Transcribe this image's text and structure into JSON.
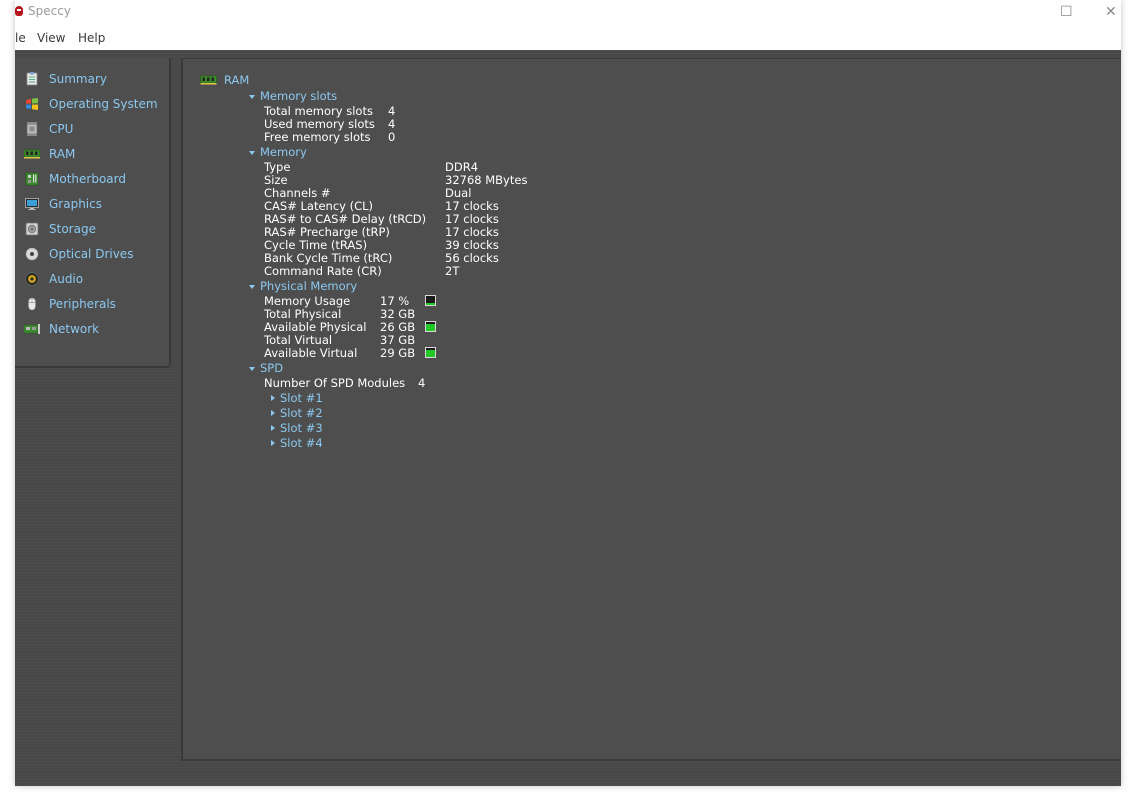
{
  "window": {
    "title": "Speccy",
    "controls": {
      "maximize": "☐",
      "close": "✕"
    }
  },
  "menu": {
    "items": [
      "le",
      "View",
      "Help"
    ]
  },
  "sidebar": {
    "items": [
      {
        "label": "Summary",
        "icon": "summary-icon",
        "selected": false
      },
      {
        "label": "Operating System",
        "icon": "windows-icon",
        "selected": false
      },
      {
        "label": "CPU",
        "icon": "cpu-icon",
        "selected": false
      },
      {
        "label": "RAM",
        "icon": "ram-icon",
        "selected": true
      },
      {
        "label": "Motherboard",
        "icon": "motherboard-icon",
        "selected": false
      },
      {
        "label": "Graphics",
        "icon": "monitor-icon",
        "selected": false
      },
      {
        "label": "Storage",
        "icon": "hard-drive-icon",
        "selected": false
      },
      {
        "label": "Optical Drives",
        "icon": "optical-disc-icon",
        "selected": false
      },
      {
        "label": "Audio",
        "icon": "speaker-icon",
        "selected": false
      },
      {
        "label": "Peripherals",
        "icon": "mouse-icon",
        "selected": false
      },
      {
        "label": "Network",
        "icon": "network-icon",
        "selected": false
      }
    ]
  },
  "content": {
    "title": "RAM",
    "memory_slots": {
      "heading": "Memory slots",
      "rows": [
        {
          "label": "Total memory slots",
          "value": "4"
        },
        {
          "label": "Used memory slots",
          "value": "4"
        },
        {
          "label": "Free memory slots",
          "value": "0"
        }
      ]
    },
    "memory": {
      "heading": "Memory",
      "rows": [
        {
          "label": "Type",
          "value": "DDR4"
        },
        {
          "label": "Size",
          "value": "32768 MBytes"
        },
        {
          "label": "Channels #",
          "value": "Dual"
        },
        {
          "label": "CAS# Latency (CL)",
          "value": "17 clocks"
        },
        {
          "label": "RAS# to CAS# Delay (tRCD)",
          "value": "17 clocks"
        },
        {
          "label": "RAS# Precharge (tRP)",
          "value": "17 clocks"
        },
        {
          "label": "Cycle Time (tRAS)",
          "value": "39 clocks"
        },
        {
          "label": "Bank Cycle Time (tRC)",
          "value": "56 clocks"
        },
        {
          "label": "Command Rate (CR)",
          "value": "2T"
        }
      ]
    },
    "physical_memory": {
      "heading": "Physical Memory",
      "rows": [
        {
          "label": "Memory Usage",
          "value": "17 %",
          "bar_fraction": 0.17
        },
        {
          "label": "Total Physical",
          "value": "32 GB"
        },
        {
          "label": "Available Physical",
          "value": "26 GB",
          "bar_fraction": 0.81
        },
        {
          "label": "Total Virtual",
          "value": "37 GB"
        },
        {
          "label": "Available Virtual",
          "value": "29 GB",
          "bar_fraction": 0.78
        }
      ]
    },
    "spd": {
      "heading": "SPD",
      "modules_label": "Number Of SPD Modules",
      "modules_value": "4",
      "slots": [
        "Slot #1",
        "Slot #2",
        "Slot #3",
        "Slot #4"
      ]
    }
  },
  "colors": {
    "link_blue": "#8cc8f0",
    "bar_green": "#22c826",
    "panel_bg": "#4e4e4e"
  }
}
